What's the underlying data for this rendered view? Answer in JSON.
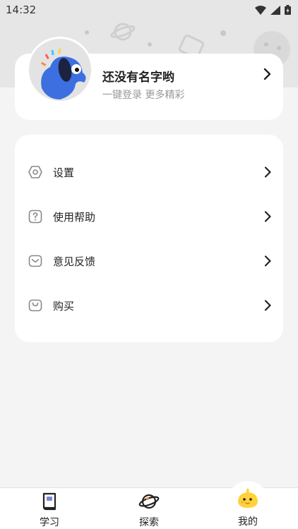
{
  "status_bar": {
    "time": "14:32"
  },
  "profile": {
    "name": "还没有名字哟",
    "subtitle": "一键登录 更多精彩"
  },
  "menu": {
    "items": [
      {
        "label": "设置",
        "icon": "settings-icon"
      },
      {
        "label": "使用帮助",
        "icon": "help-icon"
      },
      {
        "label": "意见反馈",
        "icon": "feedback-icon"
      },
      {
        "label": "购买",
        "icon": "shopping-bag-icon"
      }
    ]
  },
  "tabbar": {
    "tabs": [
      {
        "label": "学习",
        "icon": "book-icon"
      },
      {
        "label": "探索",
        "icon": "planet-icon"
      },
      {
        "label": "我的",
        "icon": "mascot-face-icon",
        "selected": true
      }
    ]
  },
  "colors": {
    "accent_yellow": "#ffd23a",
    "mascot_blue": "#3d6fe0"
  }
}
